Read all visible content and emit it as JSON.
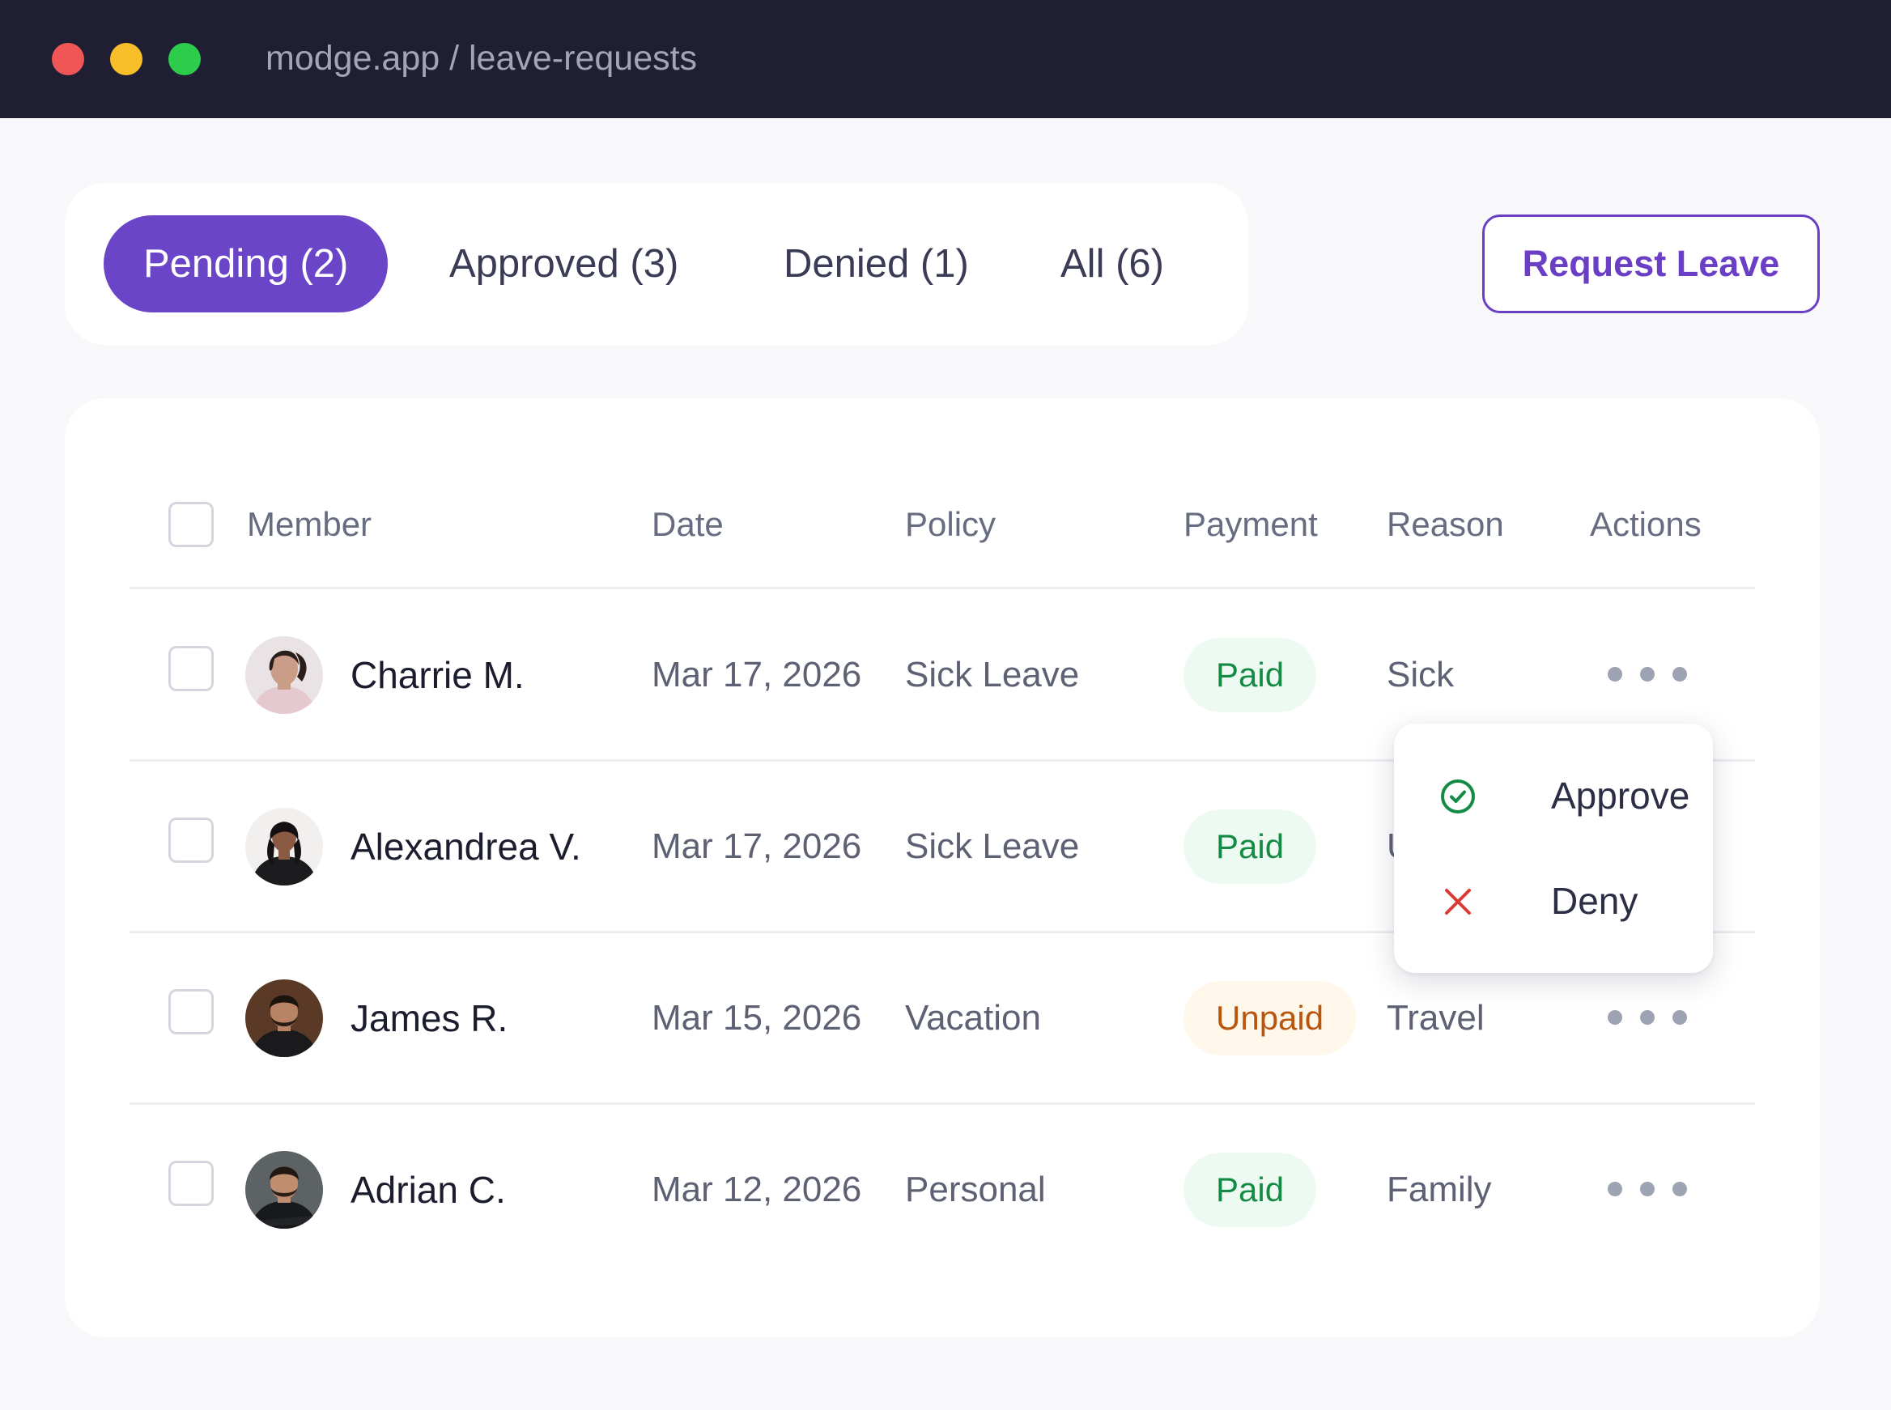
{
  "window": {
    "url": "modge.app / leave-requests",
    "traffic_lights": [
      "#f05656",
      "#f8bf2b",
      "#2dcc4a"
    ]
  },
  "tabs": [
    {
      "label": "Pending (2)",
      "active": true
    },
    {
      "label": "Approved (3)",
      "active": false
    },
    {
      "label": "Denied (1)",
      "active": false
    },
    {
      "label": "All (6)",
      "active": false
    }
  ],
  "request_button": {
    "label": "Request Leave"
  },
  "table": {
    "columns": [
      "Member",
      "Date",
      "Policy",
      "Payment",
      "Reason",
      "Actions"
    ],
    "rows": [
      {
        "name": "Charrie M.",
        "date": "Mar 17, 2026",
        "policy": "Sick Leave",
        "payment": "Paid",
        "reason": "Sick"
      },
      {
        "name": "Alexandrea V.",
        "date": "Mar 17, 2026",
        "policy": "Sick Leave",
        "payment": "Paid",
        "reason": "U"
      },
      {
        "name": "James R.",
        "date": "Mar 15, 2026",
        "policy": "Vacation",
        "payment": "Unpaid",
        "reason": "Travel"
      },
      {
        "name": "Adrian C.",
        "date": "Mar 12, 2026",
        "policy": "Personal",
        "payment": "Paid",
        "reason": "Family"
      }
    ]
  },
  "actions_menu": {
    "items": [
      {
        "label": "Approve",
        "icon": "check-circle-icon"
      },
      {
        "label": "Deny",
        "icon": "x-icon"
      }
    ]
  },
  "colors": {
    "accent": "#6a45c8",
    "paid": "#158a45",
    "unpaid": "#b9560e",
    "deny": "#d93b34",
    "titlebar": "#1f1e33"
  }
}
